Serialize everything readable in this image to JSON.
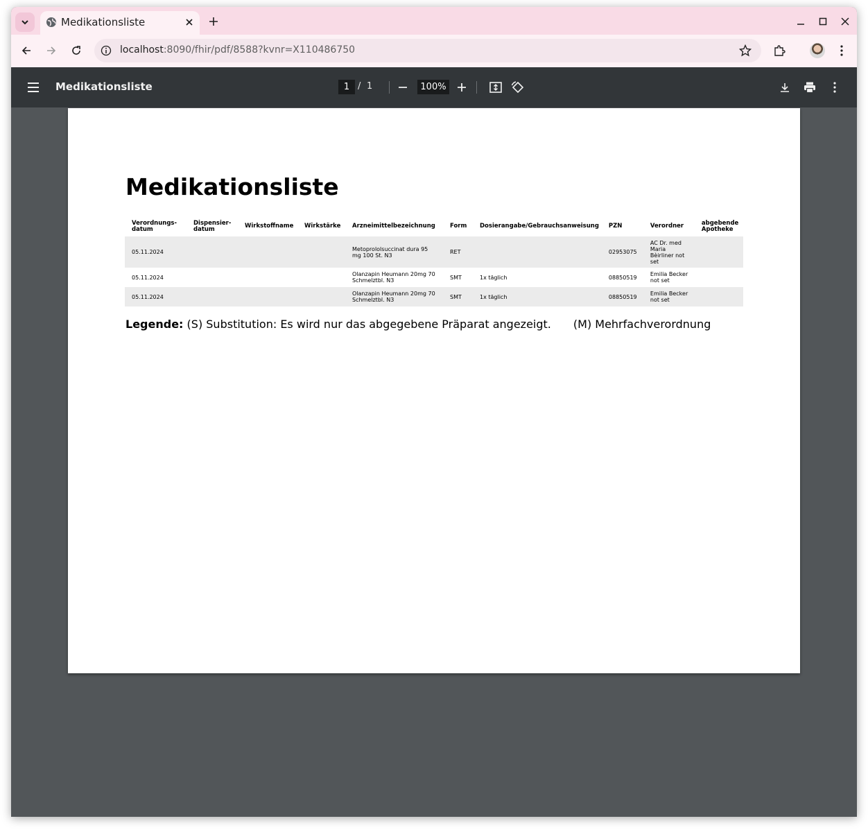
{
  "browser": {
    "tab_title": "Medikationsliste",
    "url_host": "localhost",
    "url_rest": ":8090/fhir/pdf/8588?kvnr=X110486750"
  },
  "viewer": {
    "title": "Medikationsliste",
    "page_current": "1",
    "page_separator": "/",
    "page_total": "1",
    "zoom": "100%"
  },
  "document": {
    "title": "Medikationsliste",
    "table": {
      "headers": [
        [
          "Verordnungs-",
          "datum"
        ],
        [
          "Dispensier-",
          "datum"
        ],
        [
          "Wirkstoffname"
        ],
        [
          "Wirkstärke"
        ],
        [
          "Arzneimittelbezeichnung"
        ],
        [
          "Form"
        ],
        [
          "Dosierangabe/Gebrauchsanweisung"
        ],
        [
          "PZN"
        ],
        [
          "Verordner"
        ],
        [
          "abgebende",
          "Apotheke"
        ]
      ],
      "rows": [
        {
          "verordnungsdatum": "05.11.2024",
          "dispensierdatum": "",
          "wirkstoffname": "",
          "wirkstaerke": "",
          "arzneimittel": [
            "Metoprololsuccinat dura 95",
            "mg 100 St. N3"
          ],
          "form": "RET",
          "dosierung": "",
          "pzn": "02953075",
          "verordner": [
            "AC Dr. med",
            "Maria",
            "Bèirliner not",
            "set"
          ],
          "apotheke": ""
        },
        {
          "verordnungsdatum": "05.11.2024",
          "dispensierdatum": "",
          "wirkstoffname": "",
          "wirkstaerke": "",
          "arzneimittel": [
            "Olanzapin Heumann 20mg 70",
            "Schmelztbl. N3"
          ],
          "form": "SMT",
          "dosierung": "1x täglich",
          "pzn": "08850519",
          "verordner": [
            "Emilia Becker",
            "not set"
          ],
          "apotheke": ""
        },
        {
          "verordnungsdatum": "05.11.2024",
          "dispensierdatum": "",
          "wirkstoffname": "",
          "wirkstaerke": "",
          "arzneimittel": [
            "Olanzapin Heumann 20mg 70",
            "Schmelztbl. N3"
          ],
          "form": "SMT",
          "dosierung": "1x täglich",
          "pzn": "08850519",
          "verordner": [
            "Emilia Becker",
            "not set"
          ],
          "apotheke": ""
        }
      ]
    },
    "legend": {
      "label": "Legende:",
      "substitution": "(S) Substitution: Es wird nur das abgegebene Präparat angezeigt.",
      "mehrfach": "(M) Mehrfachverordnung"
    }
  },
  "colors": {
    "tabstrip": "#f9dbe6",
    "toolbar": "#fdf1f5",
    "pdf_toolbar": "#323639",
    "viewer_background": "#525659",
    "row_stripe": "#ebebeb"
  }
}
